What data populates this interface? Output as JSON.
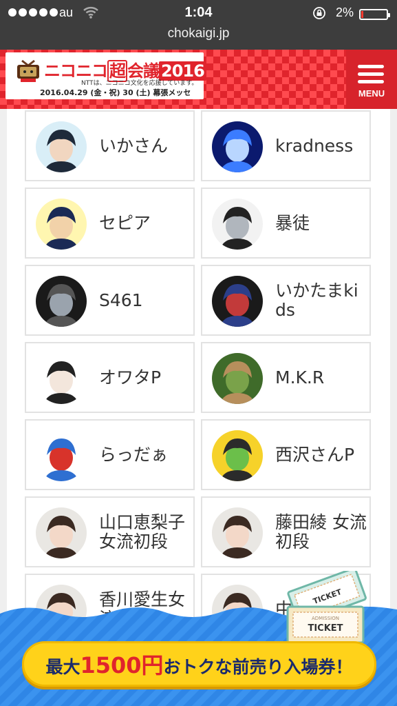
{
  "status_bar": {
    "carrier": "au",
    "time": "1:04",
    "battery": "2%",
    "url": "chokaigi.jp"
  },
  "header": {
    "logo_title_a": "ニコニコ",
    "logo_title_b": "超",
    "logo_title_c": "会議",
    "logo_year": "2016",
    "logo_sub": "NTTは、ニコニコ文化を応援しています。",
    "logo_date": "2016.04.29 (金・祝) 30 (土) 幕張メッセ",
    "menu_label": "MENU",
    "accent": "#e0242c"
  },
  "performers": [
    {
      "name": "いかさん",
      "avatar": "anime-boy-avatar"
    },
    {
      "name": "kradness",
      "avatar": "blue-light-avatar"
    },
    {
      "name": "セピア",
      "avatar": "cartoon-boy-avatar"
    },
    {
      "name": "暴徒",
      "avatar": "person-photo-avatar"
    },
    {
      "name": "S461",
      "avatar": "group-photo-avatar"
    },
    {
      "name": "いかたまkids",
      "avatar": "group-stage-avatar"
    },
    {
      "name": "オワタP",
      "avatar": "cat-ear-girl-avatar"
    },
    {
      "name": "M.K.R",
      "avatar": "camel-photo-avatar"
    },
    {
      "name": "らっだぁ",
      "avatar": "blue-beanie-character-avatar"
    },
    {
      "name": "西沢さんP",
      "avatar": "green-eyed-character-avatar"
    },
    {
      "name": "山口恵梨子女流初段",
      "avatar": "woman-portrait-avatar"
    },
    {
      "name": "藤田綾 女流初段",
      "avatar": "woman-portrait-avatar"
    },
    {
      "name": "香川愛生女流三段",
      "avatar": "woman-portrait-avatar"
    },
    {
      "name": "中村",
      "avatar": "woman-portrait-avatar"
    }
  ],
  "banner": {
    "cta_prefix": "最大",
    "cta_number": "1500円",
    "cta_suffix": "おトクな前売り入場券！",
    "ticket_label": "TICKET",
    "ticket_admission": "ADMISSION"
  }
}
